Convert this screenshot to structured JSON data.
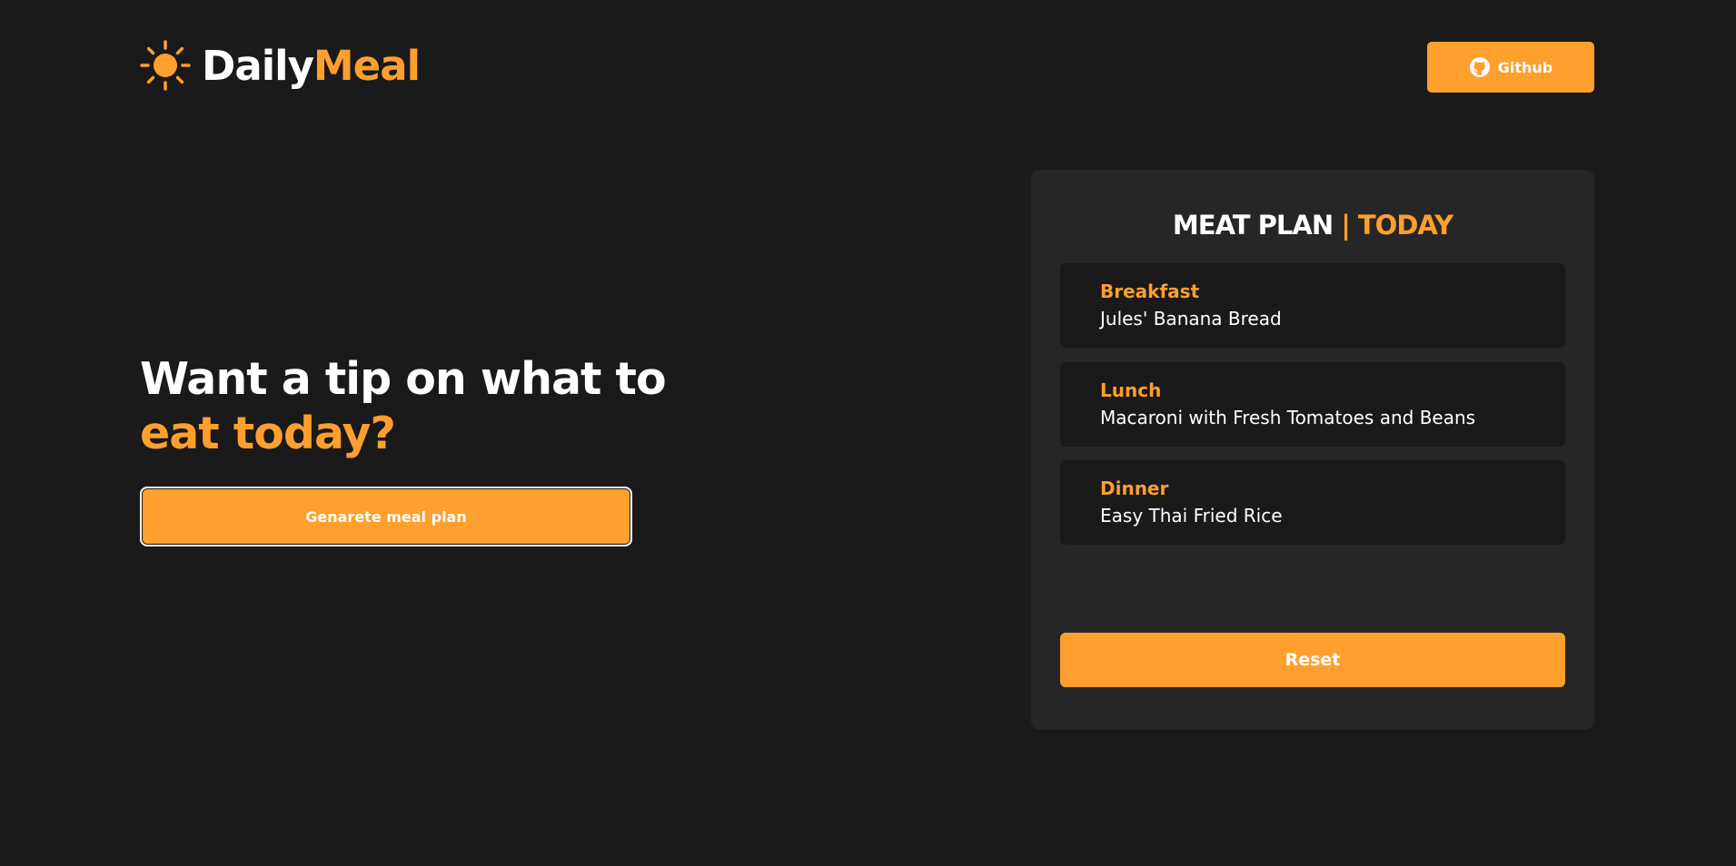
{
  "header": {
    "logo": {
      "icon": "sun-icon",
      "word1": "Daily",
      "word2": "Meal"
    },
    "github": {
      "icon": "github-icon",
      "label": "Github"
    }
  },
  "hero": {
    "line1": "Want a tip on what to",
    "line2": "eat today?",
    "generate_label": "Genarete meal plan"
  },
  "meal_plan": {
    "title_main": "MEAT PLAN",
    "title_accent": "| TODAY",
    "meals": [
      {
        "label": "Breakfast",
        "name": "Jules' Banana Bread"
      },
      {
        "label": "Lunch",
        "name": "Macaroni with Fresh Tomatoes and Beans"
      },
      {
        "label": "Dinner",
        "name": "Easy Thai Fried Rice"
      }
    ],
    "reset_label": "Reset"
  },
  "colors": {
    "background": "#1a1a1a",
    "card": "#262626",
    "accent": "#ff9f2e",
    "text": "#ffffff"
  }
}
